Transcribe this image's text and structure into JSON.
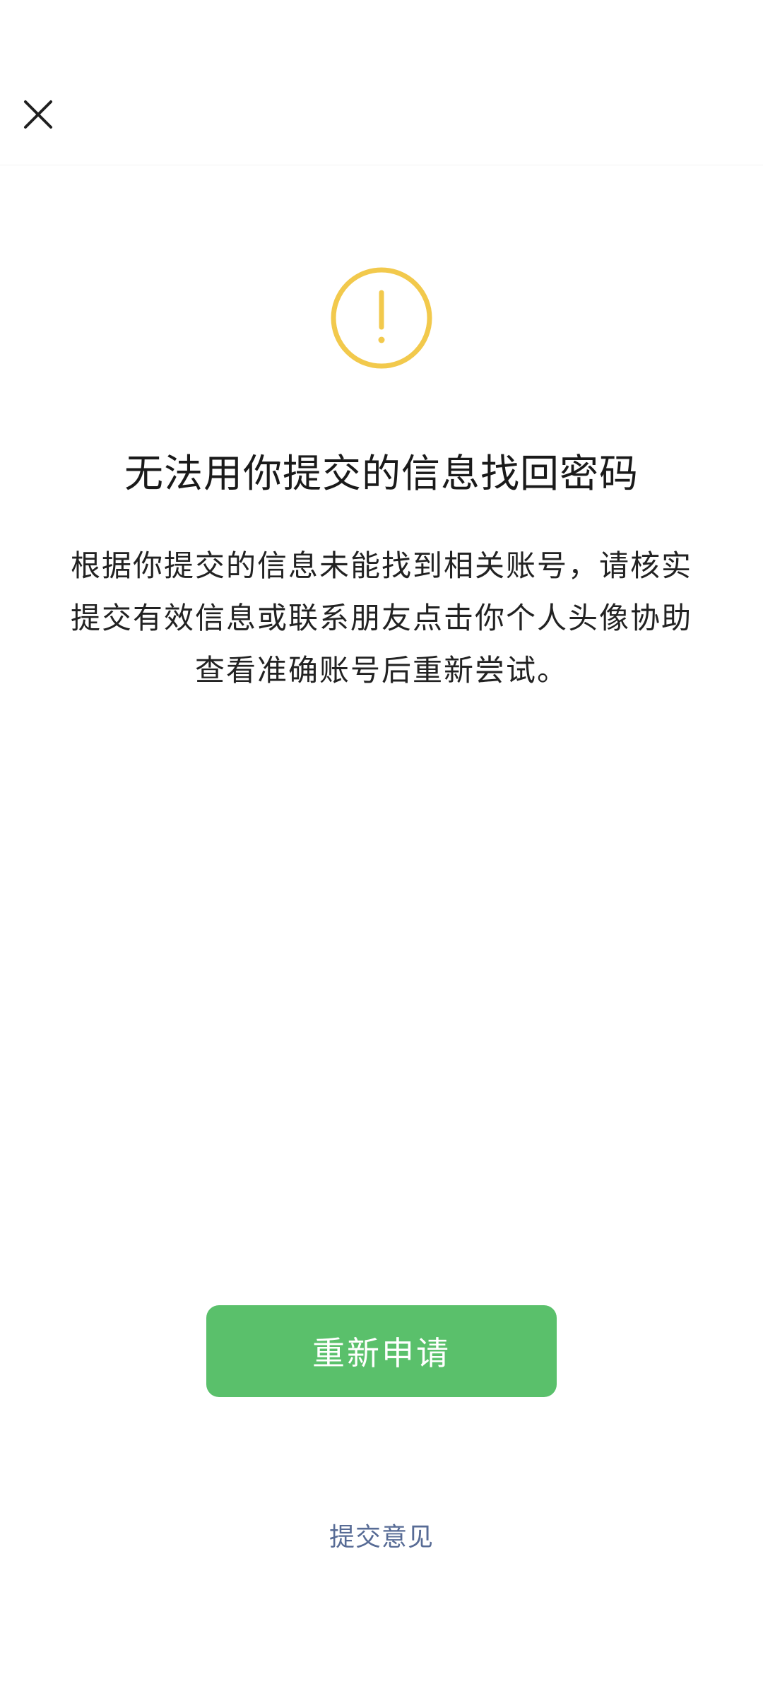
{
  "header": {
    "close_icon": "close-icon"
  },
  "status": {
    "icon": "warning-icon",
    "icon_color": "#f2c94c",
    "title": "无法用你提交的信息找回密码",
    "description": "根据你提交的信息未能找到相关账号，请核实提交有效信息或联系朋友点击你个人头像协助查看准确账号后重新尝试。"
  },
  "actions": {
    "reapply_label": "重新申请",
    "reapply_color": "#5ac06b",
    "feedback_label": "提交意见",
    "feedback_color": "#576b95"
  }
}
